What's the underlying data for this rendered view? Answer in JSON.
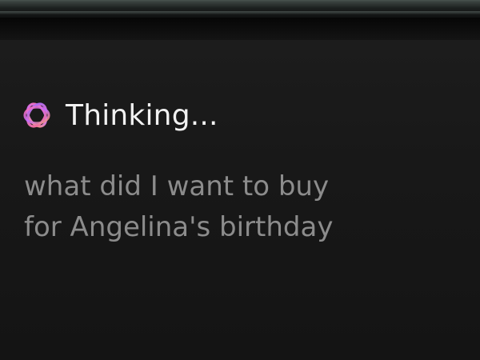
{
  "assistant": {
    "status_label": "Thinking...",
    "status_icon": "assistant-orb-icon",
    "query_text": "what did I want to buy\nfor Angelina's birthday"
  },
  "colors": {
    "background": "#141414",
    "status_text": "#f2f2f2",
    "query_text": "#8c8c8c",
    "orb_pink": "#ff6fa8",
    "orb_purple": "#a06bff",
    "orb_orange": "#ff9a6a"
  }
}
